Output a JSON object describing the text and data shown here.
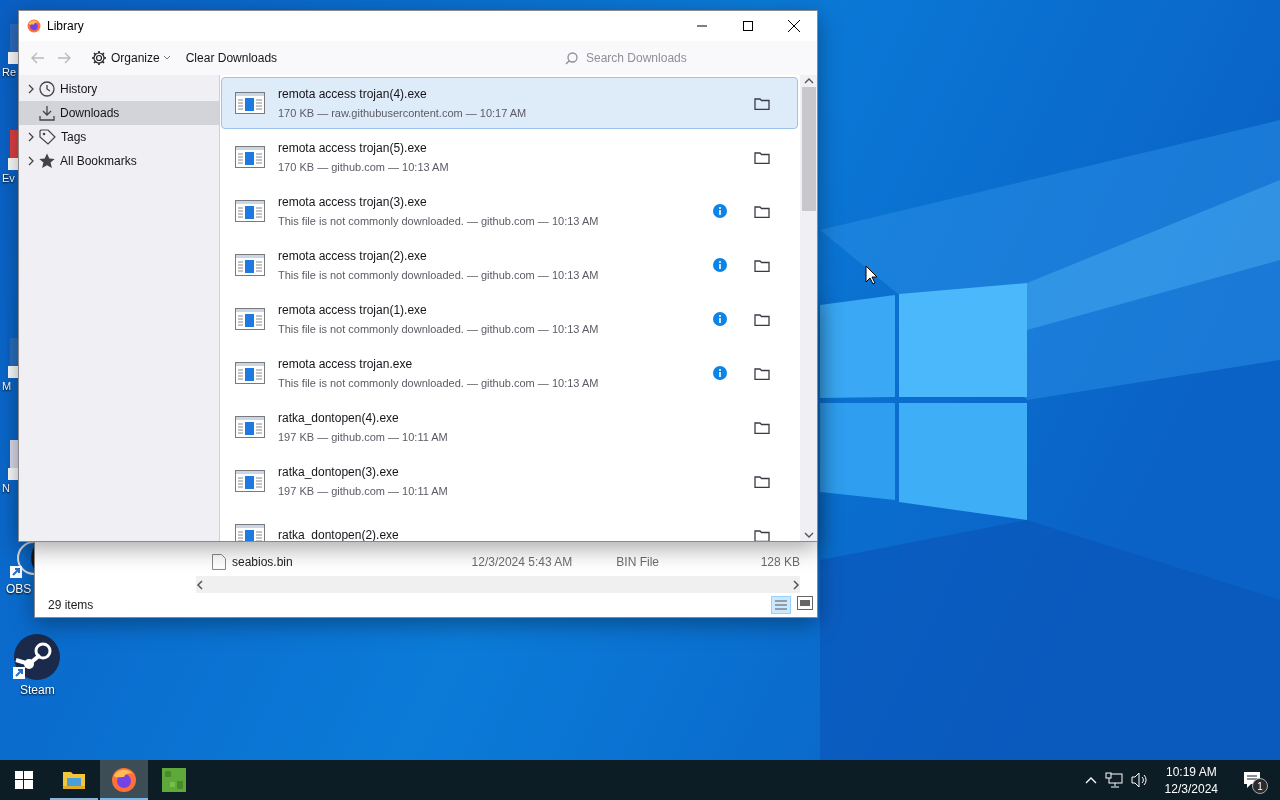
{
  "desktop_icons": [
    {
      "label": "Re"
    },
    {
      "label": "Ev"
    },
    {
      "label": "M"
    },
    {
      "label": "N"
    },
    {
      "label": "OBS"
    },
    {
      "label": "Steam"
    }
  ],
  "explorer": {
    "rows": [
      {
        "name": "seabios.bin",
        "date": "12/3/2024 5:43 AM",
        "type": "BIN File",
        "size": "128 KB"
      }
    ],
    "status": "29 items"
  },
  "library": {
    "title": "Library",
    "toolbar": {
      "organize": "Organize",
      "clear": "Clear Downloads",
      "search": {
        "placeholder": "Search Downloads"
      }
    },
    "sidebar": [
      {
        "label": "History",
        "kind": "group",
        "expanded": false,
        "selected": false
      },
      {
        "label": "Downloads",
        "kind": "item",
        "selected": true
      },
      {
        "label": "Tags",
        "kind": "group",
        "expanded": false,
        "selected": false
      },
      {
        "label": "All Bookmarks",
        "kind": "group",
        "expanded": false,
        "selected": false
      }
    ],
    "downloads": [
      {
        "name": "remota access trojan(4).exe",
        "details": "170 KB — raw.githubusercontent.com — 10:17 AM",
        "info": false,
        "selected": true
      },
      {
        "name": "remota access trojan(5).exe",
        "details": "170 KB — github.com — 10:13 AM",
        "info": false,
        "selected": false
      },
      {
        "name": "remota access trojan(3).exe",
        "details": "This file is not commonly downloaded. — github.com — 10:13 AM",
        "info": true,
        "selected": false
      },
      {
        "name": "remota access trojan(2).exe",
        "details": "This file is not commonly downloaded. — github.com — 10:13 AM",
        "info": true,
        "selected": false
      },
      {
        "name": "remota access trojan(1).exe",
        "details": "This file is not commonly downloaded. — github.com — 10:13 AM",
        "info": true,
        "selected": false
      },
      {
        "name": "remota access trojan.exe",
        "details": "This file is not commonly downloaded. — github.com — 10:13 AM",
        "info": true,
        "selected": false
      },
      {
        "name": "ratka_dontopen(4).exe",
        "details": "197 KB — github.com — 10:11 AM",
        "info": false,
        "selected": false
      },
      {
        "name": "ratka_dontopen(3).exe",
        "details": "197 KB — github.com — 10:11 AM",
        "info": false,
        "selected": false
      },
      {
        "name": "ratka_dontopen(2).exe",
        "info": false,
        "selected": false
      }
    ]
  },
  "taskbar": {
    "apps": [
      {
        "running": true,
        "selected": false
      },
      {
        "running": true,
        "selected": true
      },
      {
        "running": false,
        "selected": false
      }
    ],
    "time": "10:19 AM",
    "date": "12/3/2024",
    "notifications": "1"
  }
}
